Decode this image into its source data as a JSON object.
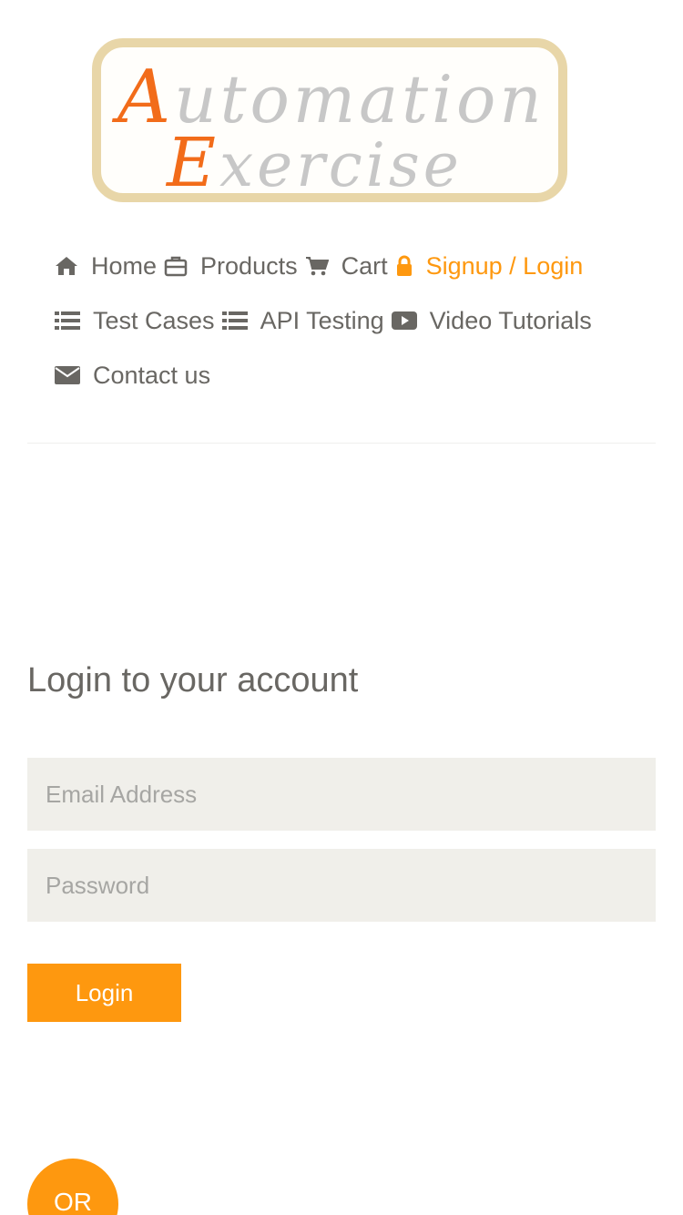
{
  "logo": {
    "line1_cap": "A",
    "line1_rest": "utomation",
    "line2_cap": "E",
    "line2_rest": "xercise"
  },
  "nav": {
    "row1": [
      {
        "label": "Home",
        "icon": "home-icon"
      },
      {
        "label": "Products",
        "icon": "briefcase-icon"
      },
      {
        "label": "Cart",
        "icon": "cart-icon"
      },
      {
        "label": "Signup / Login",
        "icon": "lock-icon",
        "active": true
      }
    ],
    "row2": [
      {
        "label": "Test Cases",
        "icon": "list-icon"
      },
      {
        "label": "API Testing",
        "icon": "list-icon"
      },
      {
        "label": "Video Tutorials",
        "icon": "youtube-play-icon"
      }
    ],
    "row3": [
      {
        "label": "Contact us",
        "icon": "envelope-icon"
      }
    ]
  },
  "login": {
    "title": "Login to your account",
    "email_placeholder": "Email Address",
    "password_placeholder": "Password",
    "button_label": "Login"
  },
  "or_label": "OR",
  "colors": {
    "accent": "#fe980f",
    "text": "#696763",
    "input_bg": "#f0efea",
    "logo_border": "#e8d6a8",
    "logo_red": "#f26c1a"
  }
}
